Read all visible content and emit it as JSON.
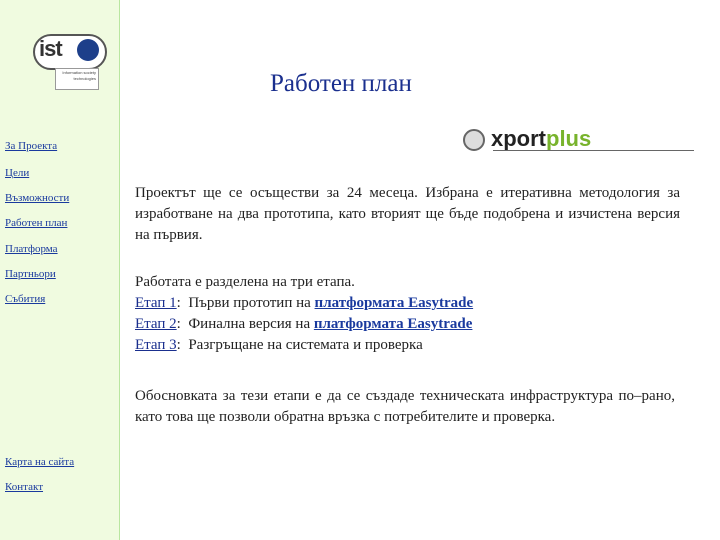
{
  "logo": {
    "text": "ist",
    "tagline": "Information society technologies"
  },
  "nav": {
    "top": [
      "За Проекта",
      "Цели",
      "Възможности",
      "Работен план",
      "Платформа",
      "Партньори",
      "Събития"
    ],
    "bottom": [
      "Карта на сайта",
      "Контакт"
    ]
  },
  "page": {
    "title": "Работен план"
  },
  "partner_logo": {
    "part1": "xport",
    "part2": "plus"
  },
  "content": {
    "intro": "Проектът ще се осъществи за 24 месеца. Избрана е итеративна методология за изработване на два прототипа, като вторият ще бъде подобрена и изчистена версия на първия.",
    "stages_intro": "Работата е разделена на три етапа.",
    "stages": [
      {
        "label": "Етап 1",
        "text": "Първи прототип на ",
        "link": "платформата Easytrade"
      },
      {
        "label": "Етап 2",
        "text": "Финална версия на ",
        "link": "платформата Easytrade"
      },
      {
        "label": "Етап 3",
        "text": "Разгръщане на системата и проверка",
        "link": ""
      }
    ],
    "rationale": "Обосновката за тези етапи е да се създаде техническата инфраструктура по–рано, като това ще позволи обратна връзка с потребителите и проверка."
  },
  "colors": {
    "sidebar_bg": "#f0fbe0",
    "title": "#1a2f8e",
    "link": "#1a3a9e",
    "brand_green": "#78b32c"
  }
}
